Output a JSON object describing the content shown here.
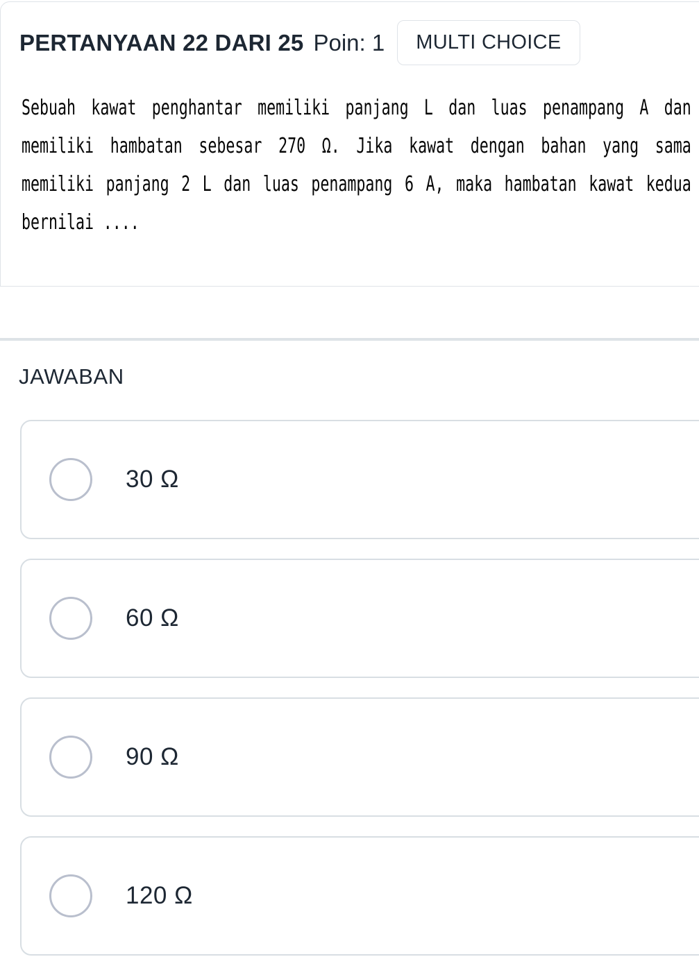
{
  "header": {
    "title": "PERTANYAAN 22 DARI 25",
    "points": "Poin: 1",
    "badge": "MULTI CHOICE"
  },
  "question": {
    "text": "Sebuah kawat penghantar memiliki panjang L dan luas penampang A dan memiliki hambatan sebesar 270 Ω. Jika kawat dengan bahan yang sama memiliki panjang 2 L dan luas penampang 6 A, maka hambatan kawat kedua bernilai ...."
  },
  "answers": {
    "heading": "JAWABAN",
    "options": [
      {
        "label": "30 Ω",
        "selected": false
      },
      {
        "label": "60 Ω",
        "selected": false
      },
      {
        "label": "90 Ω",
        "selected": false
      },
      {
        "label": "120 Ω",
        "selected": false
      }
    ]
  },
  "colors": {
    "text": "#1d2733",
    "border": "#dfe3e8",
    "option_border": "#d8dee3",
    "radio_border": "#b9bfcd",
    "divider": "#dde3e7",
    "background": "#ffffff"
  }
}
